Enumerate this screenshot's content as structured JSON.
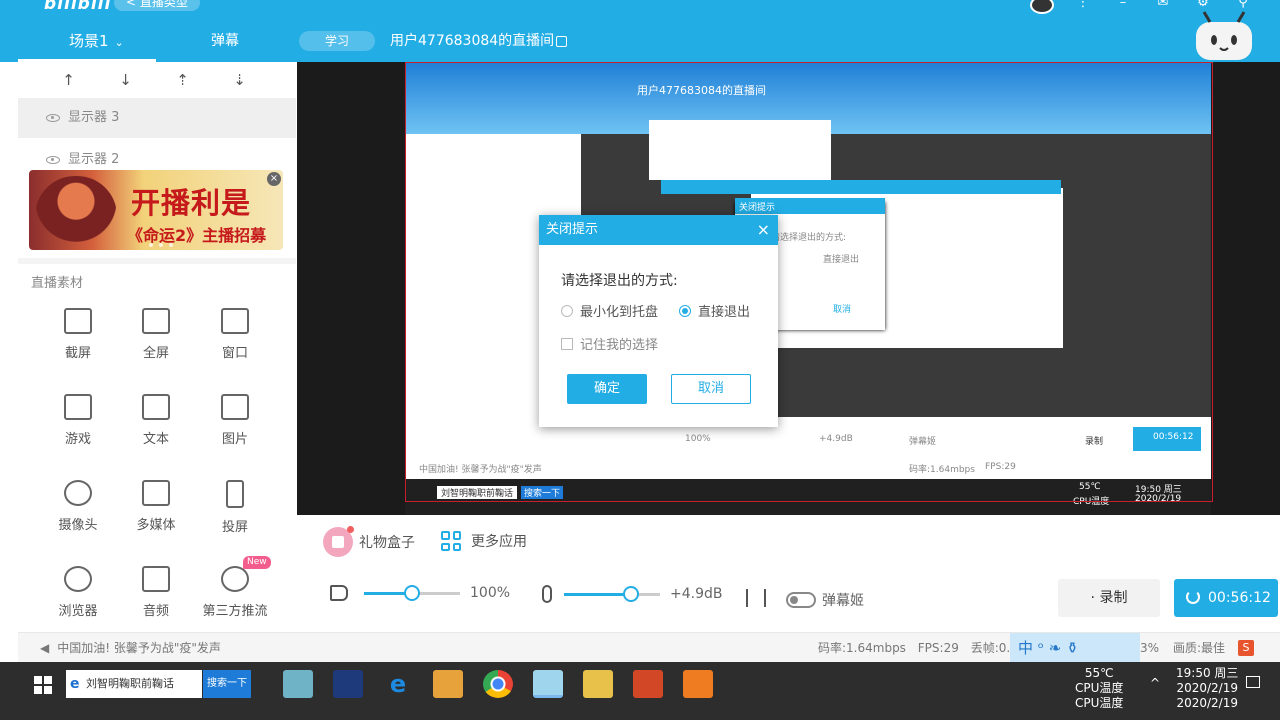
{
  "header": {
    "logo": "bilibili",
    "live_type": "< 直播类型",
    "scene_tab": "场景1",
    "danmu_tab": "弹幕",
    "study_tag": "学习",
    "room_title": "用户477683084的直播间"
  },
  "sources": {
    "items": [
      {
        "label": "显示器 3",
        "selected": true
      },
      {
        "label": "显示器 2",
        "selected": false
      }
    ]
  },
  "banner": {
    "headline": "开播利是",
    "subline": "《命运2》主播招募"
  },
  "materials": {
    "title": "直播素材",
    "items": [
      {
        "label": "截屏",
        "icon": "crop-icon"
      },
      {
        "label": "全屏",
        "icon": "monitor-icon"
      },
      {
        "label": "窗口",
        "icon": "window-icon"
      },
      {
        "label": "游戏",
        "icon": "gamepad-icon"
      },
      {
        "label": "文本",
        "icon": "text-icon"
      },
      {
        "label": "图片",
        "icon": "image-icon"
      },
      {
        "label": "摄像头",
        "icon": "camera-icon"
      },
      {
        "label": "多媒体",
        "icon": "media-icon"
      },
      {
        "label": "投屏",
        "icon": "phone-icon"
      },
      {
        "label": "浏览器",
        "icon": "browser-icon"
      },
      {
        "label": "音频",
        "icon": "music-icon"
      },
      {
        "label": "第三方推流",
        "icon": "stream-icon",
        "badge": "New"
      }
    ]
  },
  "dialog": {
    "title": "关闭提示",
    "question": "请选择退出的方式:",
    "option_tray": "最小化到托盘",
    "option_exit": "直接退出",
    "selected": "exit",
    "remember": "记住我的选择",
    "ok": "确定",
    "cancel": "取消"
  },
  "controls": {
    "gift": "礼物盒子",
    "more_apps": "更多应用",
    "volume_label": "100%",
    "volume_level": 0.5,
    "mic_label": "+4.9dB",
    "mic_level": 0.7,
    "danmu_girl": "弹幕姬",
    "record": "录制",
    "live_timer": "00:56:12"
  },
  "status": {
    "announcement": "中国加油! 张馨予为战\"疫\"发声",
    "bitrate": "码率:1.64mbps",
    "fps": "FPS:29",
    "drop": "丢帧:0.",
    "pct": "3%",
    "quality": "画质:最佳",
    "ime": "中 ᵒ ❧ ⚱"
  },
  "taskbar": {
    "search_text": "刘智明鞠职前鞠话",
    "search_button": "搜索一下",
    "temp": "55℃",
    "temp_label": "CPU温度",
    "time": "19:50 周三",
    "date": "2020/2/19",
    "temp_label_ghost": "CPU温度",
    "date_ghost": "2020/2/19",
    "preview_time": "19:50 周三",
    "preview_date": "2020/2/19"
  },
  "preview": {
    "mini_title": "用户477683084的直播间",
    "mini_dialog_title": "关闭提示",
    "mini_question": "请选择退出的方式:",
    "mini_exit": "直接退出",
    "mini_cancel": "取消",
    "mini_vol": "100%",
    "mini_mic": "+4.9dB",
    "mini_danmu": "弹幕姬",
    "mini_record": "录制",
    "mini_timer": "00:56:12",
    "mini_bitrate": "码率:1.64mbps",
    "mini_fps": "FPS:29",
    "mini_search": "刘智明鞠职前鞠话",
    "mini_search_btn": "搜索一下",
    "mini_cpu": "55℃",
    "mini_cpu_label": "CPU温度",
    "mini_announcement": "中国加油! 张馨予为战\"疫\"发声"
  }
}
